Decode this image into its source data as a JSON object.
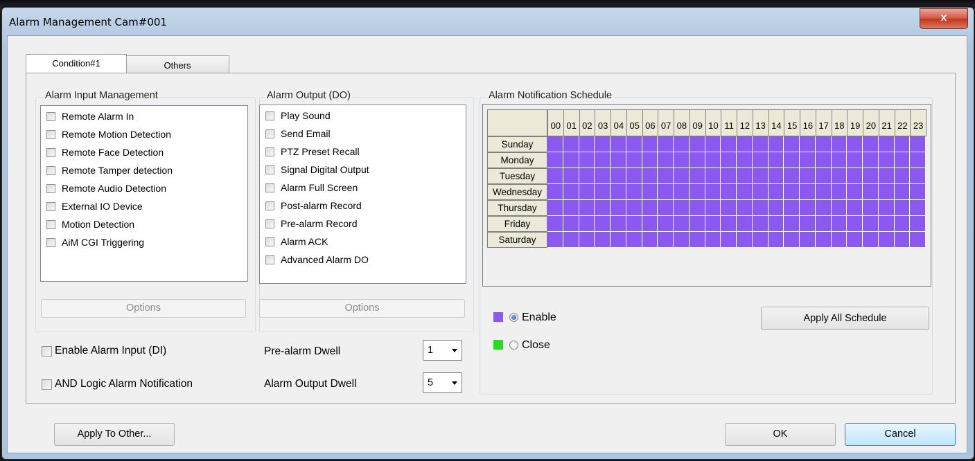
{
  "window": {
    "title": "Alarm Management Cam#001",
    "close_glyph": "x"
  },
  "tabs": [
    {
      "label": "Condition#1",
      "active": true
    },
    {
      "label": "Others",
      "active": false
    }
  ],
  "alarm_input": {
    "title": "Alarm Input Management",
    "items": [
      "Remote Alarm In",
      "Remote Motion Detection",
      "Remote Face Detection",
      "Remote Tamper detection",
      "Remote Audio Detection",
      "External IO Device",
      "Motion Detection",
      "AiM CGI Triggering"
    ],
    "options_label": "Options"
  },
  "alarm_output": {
    "title": "Alarm Output (DO)",
    "items": [
      "Play Sound",
      "Send Email",
      "PTZ Preset Recall",
      "Signal Digital Output",
      "Alarm Full Screen",
      "Post-alarm Record",
      "Pre-alarm Record",
      "Alarm ACK",
      "Advanced Alarm DO"
    ],
    "options_label": "Options"
  },
  "bottom_left": {
    "enable_di_label": "Enable Alarm Input (DI)",
    "and_logic_label": "AND Logic Alarm Notification",
    "pre_alarm_dwell_label": "Pre-alarm Dwell",
    "pre_alarm_dwell_value": "1",
    "alarm_output_dwell_label": "Alarm Output Dwell",
    "alarm_output_dwell_value": "5"
  },
  "schedule": {
    "title": "Alarm Notification Schedule",
    "hours": [
      "00",
      "01",
      "02",
      "03",
      "04",
      "05",
      "06",
      "07",
      "08",
      "09",
      "10",
      "11",
      "12",
      "13",
      "14",
      "15",
      "16",
      "17",
      "18",
      "19",
      "20",
      "21",
      "22",
      "23"
    ],
    "days": [
      "Sunday",
      "Monday",
      "Tuesday",
      "Wednesday",
      "Thursday",
      "Friday",
      "Saturday"
    ],
    "cell_color": "#8b58f0",
    "enable_label": "Enable",
    "enable_color": "#8b58f0",
    "close_label": "Close",
    "close_color": "#22dd22",
    "selected": "enable",
    "apply_all_label": "Apply All Schedule"
  },
  "footer": {
    "apply_other_label": "Apply To Other...",
    "ok_label": "OK",
    "cancel_label": "Cancel"
  }
}
